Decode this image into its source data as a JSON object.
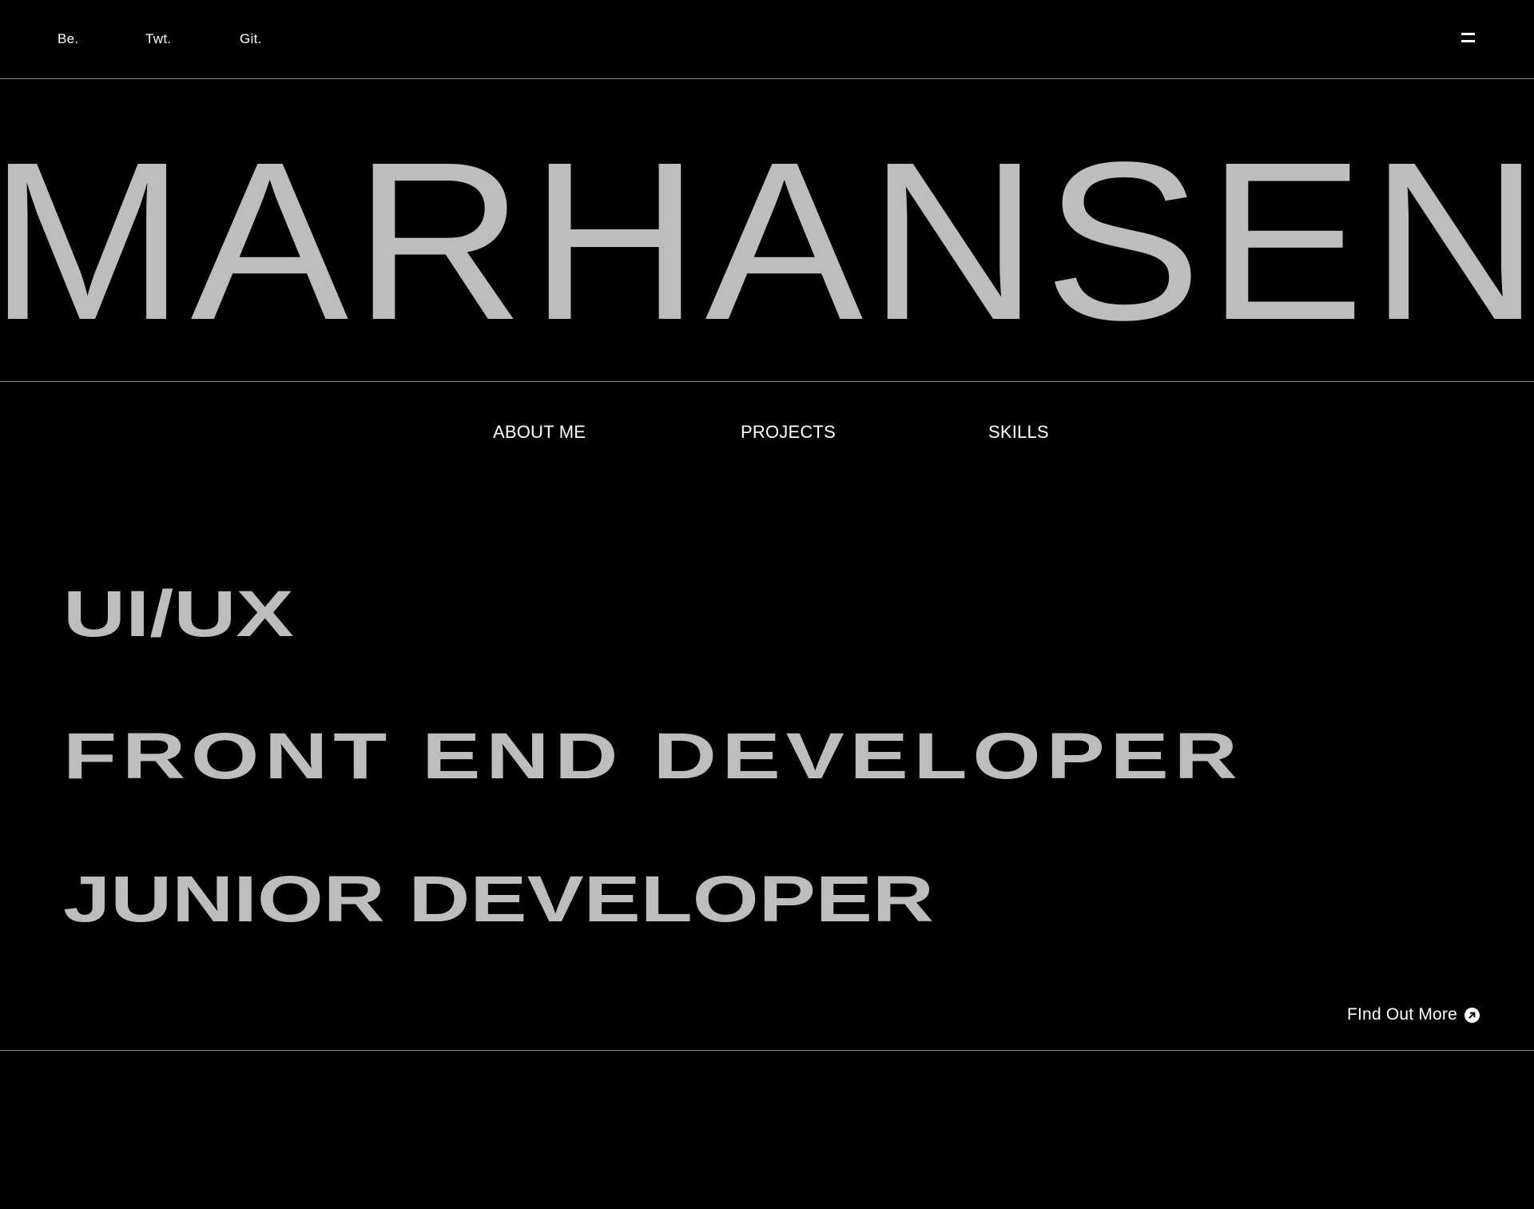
{
  "social": {
    "behance_label": "Be.",
    "twitter_label": "Twt.",
    "github_label": "Git."
  },
  "menu": {
    "icon": "hamburger-menu-icon"
  },
  "hero": {
    "title": "MARHANSEN"
  },
  "nav": {
    "items": [
      {
        "label": "ABOUT ME"
      },
      {
        "label": "PROJECTS"
      },
      {
        "label": "SKILLS"
      }
    ]
  },
  "roles": [
    {
      "label": "UI/UX"
    },
    {
      "label": "FRONT END DEVELOPER"
    },
    {
      "label": "JUNIOR DEVELOPER"
    }
  ],
  "cta": {
    "label": "FInd Out More",
    "icon": "arrow-up-right-circle-icon"
  },
  "colors": {
    "background": "#000000",
    "text": "#ffffff",
    "title_gray": "#bdbdbd",
    "rule": "#8a8a8a"
  }
}
